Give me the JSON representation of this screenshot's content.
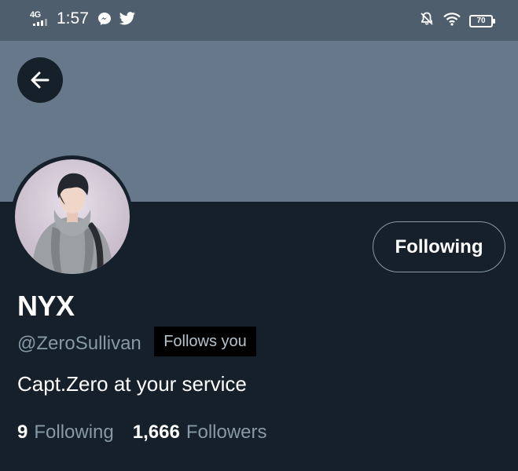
{
  "status_bar": {
    "network": "4G",
    "time": "1:57",
    "notification_icons": [
      "messenger-icon",
      "twitter-icon"
    ],
    "right_icons": [
      "bell-off-icon",
      "wifi-icon"
    ],
    "battery": "70"
  },
  "header": {
    "back_icon": "arrow-left-icon"
  },
  "profile": {
    "follow_button_label": "Following",
    "display_name": "NYX",
    "handle": "@ZeroSullivan",
    "follows_you_badge": "Follows you",
    "bio": "Capt.Zero at your service",
    "stats": [
      {
        "count": "9",
        "label": "Following"
      },
      {
        "count": "1,666",
        "label": "Followers"
      }
    ]
  },
  "colors": {
    "status_bar_bg": "#4e5e6c",
    "banner_bg": "#66788a",
    "page_bg": "#15202b",
    "muted_text": "#8899a6",
    "badge_bg": "#000000"
  }
}
